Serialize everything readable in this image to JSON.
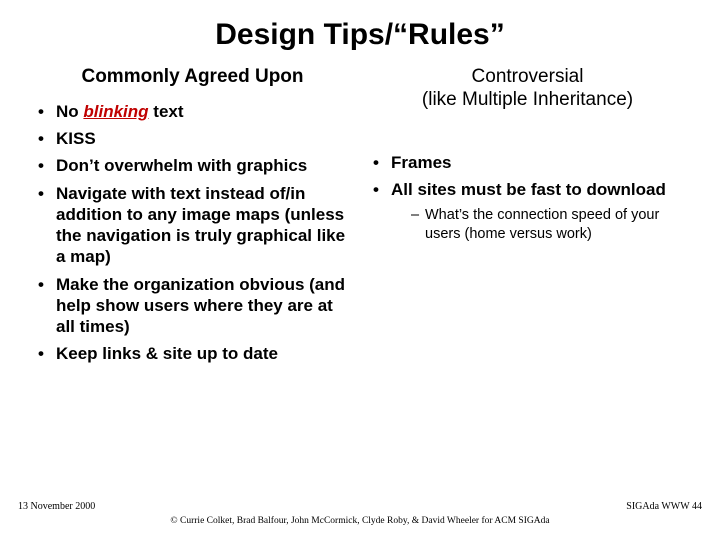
{
  "title": "Design Tips/“Rules”",
  "left": {
    "header": "Commonly Agreed Upon",
    "items": {
      "i0_pre": "No ",
      "i0_blink": "blinking",
      "i0_post": " text",
      "i1": "KISS",
      "i2": "Don’t overwhelm with graphics",
      "i3": "Navigate with text instead of/in addition to any image maps (unless the navigation is truly graphical like a map)",
      "i4": "Make the organization obvious (and help show users where they are at all times)",
      "i5": "Keep links & site up to date"
    }
  },
  "right": {
    "header_line1": "Controversial",
    "header_line2": "(like Multiple Inheritance)",
    "items": {
      "r0": "Frames",
      "r1": "All sites must be fast to download",
      "r1_sub0": "What’s the connection speed of your users (home versus work)"
    }
  },
  "footer": {
    "date": "13 November 2000",
    "right": "SIGAda WWW 44",
    "center": "© Currie Colket, Brad Balfour, John McCormick, Clyde Roby, & David Wheeler for ACM SIGAda"
  }
}
